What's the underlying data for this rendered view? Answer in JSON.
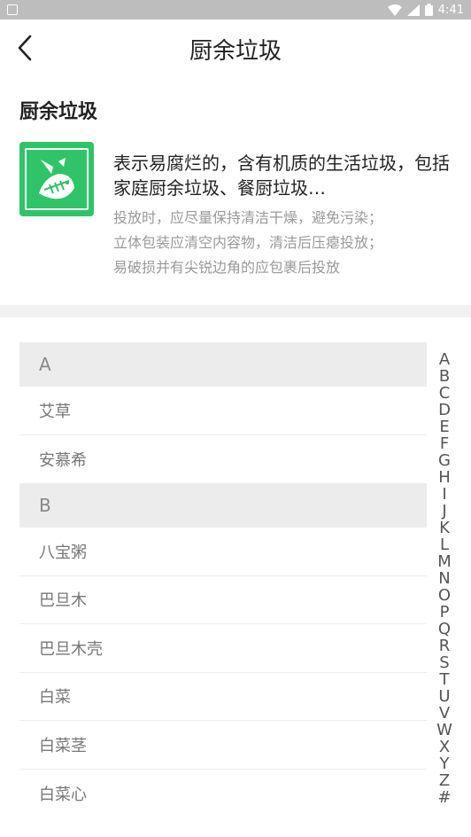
{
  "status_bar": {
    "time": "4:41"
  },
  "header": {
    "title": "厨余垃圾"
  },
  "category": {
    "title": "厨余垃圾",
    "description": "表示易腐烂的，含有机质的生活垃圾，包括家庭厨余垃圾、餐厨垃圾…",
    "tip_lines": [
      "投放时，应尽量保持清洁干燥，避免污染；",
      "立体包装应清空内容物，清洁后压瘪投放；",
      "易破损并有尖锐边角的应包裹后投放"
    ]
  },
  "groups": [
    {
      "letter": "A",
      "items": [
        "艾草",
        "安慕希"
      ]
    },
    {
      "letter": "B",
      "items": [
        "八宝粥",
        "巴旦木",
        "巴旦木壳",
        "白菜",
        "白菜茎",
        "白菜心"
      ]
    }
  ],
  "index_letters": [
    "A",
    "B",
    "C",
    "D",
    "E",
    "F",
    "G",
    "H",
    "I",
    "J",
    "K",
    "L",
    "M",
    "N",
    "O",
    "P",
    "Q",
    "R",
    "S",
    "T",
    "U",
    "V",
    "W",
    "X",
    "Y",
    "Z",
    "#"
  ],
  "colors": {
    "accent": "#2fc468",
    "status_bar": "#bdbdbd"
  }
}
